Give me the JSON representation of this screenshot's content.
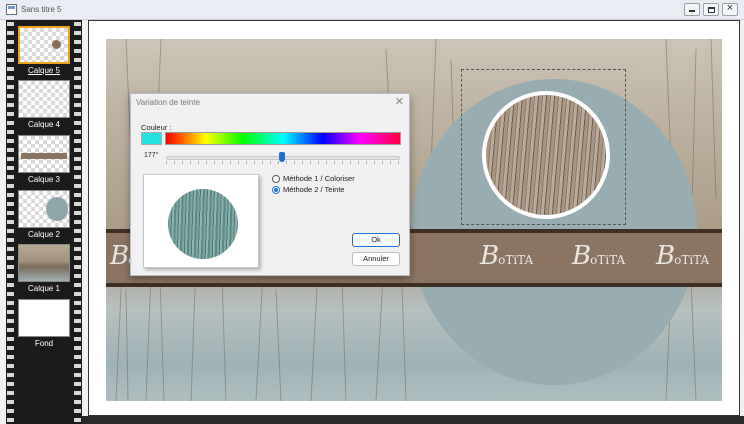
{
  "window": {
    "title": "Sans titre 5"
  },
  "layers": [
    {
      "label": "Calque 5",
      "current": true
    },
    {
      "label": "Calque 4",
      "current": false
    },
    {
      "label": "Calque 3",
      "current": false
    },
    {
      "label": "Calque 2",
      "current": false
    },
    {
      "label": "Calque 1",
      "current": false
    },
    {
      "label": "Fond",
      "current": false
    }
  ],
  "canvas": {
    "watermark": [
      "B",
      "oTiTA"
    ]
  },
  "dialog": {
    "title": "Variation de teinte",
    "color_label": "Couleur :",
    "selected_color": "#26e2de",
    "hue_value": "177°",
    "hue_degrees": 177,
    "methods": [
      {
        "label": "Méthode 1 / Coloriser",
        "selected": false
      },
      {
        "label": "Méthode 2 / Teinte",
        "selected": true
      }
    ],
    "ok_label": "Ok",
    "cancel_label": "Annuler"
  },
  "colors": {
    "accent": "#1f6fd1",
    "active_layer_border": "#f0a41e"
  }
}
